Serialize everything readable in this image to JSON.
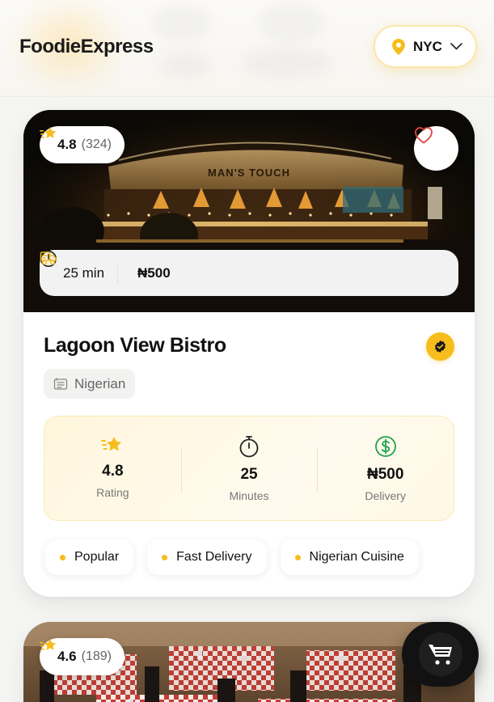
{
  "header": {
    "logo": "FoodieExpress",
    "city": "NYC"
  },
  "restaurants": [
    {
      "rating": "4.8",
      "reviews": "(324)",
      "time": "25 min",
      "fee": "₦500",
      "name": "Lagoon View Bistro",
      "cuisine": "Nigerian",
      "stats": [
        {
          "value": "4.8",
          "label": "Rating",
          "icon": "star-icon"
        },
        {
          "value": "25",
          "label": "Minutes",
          "icon": "stopwatch-icon"
        },
        {
          "value": "₦500",
          "label": "Delivery",
          "icon": "dollar-circle-icon"
        }
      ],
      "tags": [
        "Popular",
        "Fast Delivery",
        "Nigerian Cuisine"
      ],
      "sign_text": "MAN'S TOUCH"
    },
    {
      "rating": "4.6",
      "reviews": "(189)"
    }
  ],
  "colors": {
    "accent": "#f6bd1c",
    "heart": "#e0433c",
    "delivery_green": "#1fa34a"
  }
}
